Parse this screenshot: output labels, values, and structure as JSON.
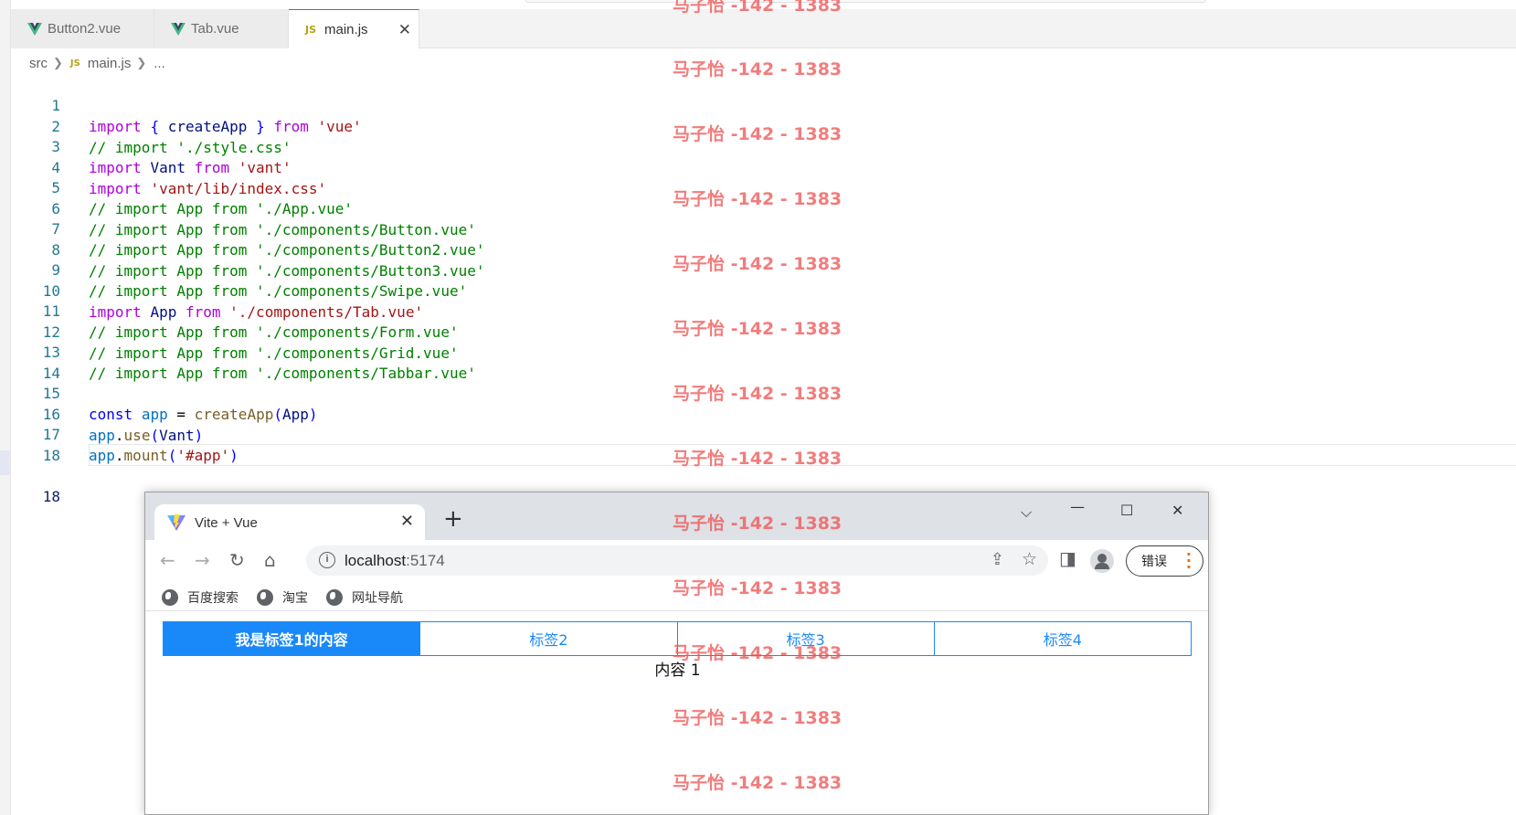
{
  "editor": {
    "tabs": [
      {
        "label": "Button2.vue",
        "icon": "vue-icon"
      },
      {
        "label": "Tab.vue",
        "icon": "vue-icon"
      },
      {
        "label": "main.js",
        "icon": "js-icon",
        "active": true
      }
    ],
    "js_icon_text": "JS",
    "close_glyph": "✕",
    "breadcrumb": {
      "folder": "src",
      "file": "main.js",
      "more": "..."
    },
    "line_numbers": [
      "1",
      "2",
      "3",
      "4",
      "5",
      "6",
      "7",
      "8",
      "9",
      "10",
      "11",
      "12",
      "13",
      "14",
      "15",
      "16",
      "17",
      "18"
    ],
    "lines": {
      "l1": {
        "kw": "import",
        "b1": "{",
        "name": "createApp",
        "b2": "}",
        "from": "from",
        "src": "'vue'"
      },
      "l2": "// import './style.css'",
      "l3": {
        "kw": "import",
        "name": "Vant",
        "from": "from",
        "src": "'vant'"
      },
      "l4": {
        "kw": "import",
        "src": "'vant/lib/index.css'"
      },
      "l5": "// import App from './App.vue'",
      "l6": "// import App from './components/Button.vue'",
      "l7": "// import App from './components/Button2.vue'",
      "l8": "// import App from './components/Button3.vue'",
      "l9": "// import App from './components/Swipe.vue'",
      "l10": {
        "kw": "import",
        "name": "App",
        "from": "from",
        "src": "'./components/Tab.vue'"
      },
      "l11": "// import App from './components/Form.vue'",
      "l12": "// import App from './components/Grid.vue'",
      "l13": "// import App from './components/Tabbar.vue'",
      "l15": {
        "kw": "const",
        "var": "app",
        "op": "=",
        "fn": "createApp",
        "arg": "App"
      },
      "l16": {
        "obj": "app",
        "fn": "use",
        "arg": "Vant"
      },
      "l17": {
        "obj": "app",
        "fn": "mount",
        "arg": "'#app'"
      }
    }
  },
  "browser": {
    "tab_title": "Vite + Vue",
    "close_glyph": "✕",
    "new_tab_glyph": "+",
    "url_host": "localhost",
    "url_port": ":5174",
    "error_button": "错误",
    "bookmarks": [
      "百度搜索",
      "淘宝",
      "网址导航"
    ],
    "vant_tabs": [
      "我是标签1的内容",
      "标签2",
      "标签3",
      "标签4"
    ],
    "content": "内容 1"
  },
  "watermark": "马子怡 -142 - 1383",
  "colors": {
    "accent": "#1989fa",
    "keyword": "#af00db",
    "comment": "#008000",
    "string": "#a31515",
    "watermark": "#ee5050"
  }
}
